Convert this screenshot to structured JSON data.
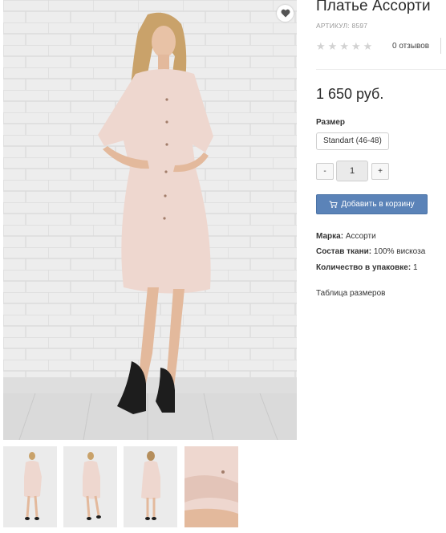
{
  "product": {
    "title": "Платье Ассорти",
    "sku": "АРТИКУЛ: 8597",
    "rating_stars": 0,
    "reviews": "0 отзывов",
    "price": "1 650 руб."
  },
  "size": {
    "label": "Размер",
    "selected": "Standart (46-48)"
  },
  "quantity": {
    "minus": "-",
    "value": "1",
    "plus": "+"
  },
  "cart": {
    "label": "Добавить в корзину",
    "icon": "cart-icon"
  },
  "attributes": {
    "brand_key": "Марка:",
    "brand_val": "Ассорти",
    "fabric_key": "Состав ткани:",
    "fabric_val": "100% вискоза",
    "pack_key": "Количество в упаковке:",
    "pack_val": "1"
  },
  "size_table_link": "Таблица размеров",
  "colors": {
    "button": "#5b83b8",
    "dress": "#eed7cf",
    "wall": "#e9e9e9"
  },
  "icons": {
    "wishlist": "heart-icon",
    "star": "star-icon"
  }
}
